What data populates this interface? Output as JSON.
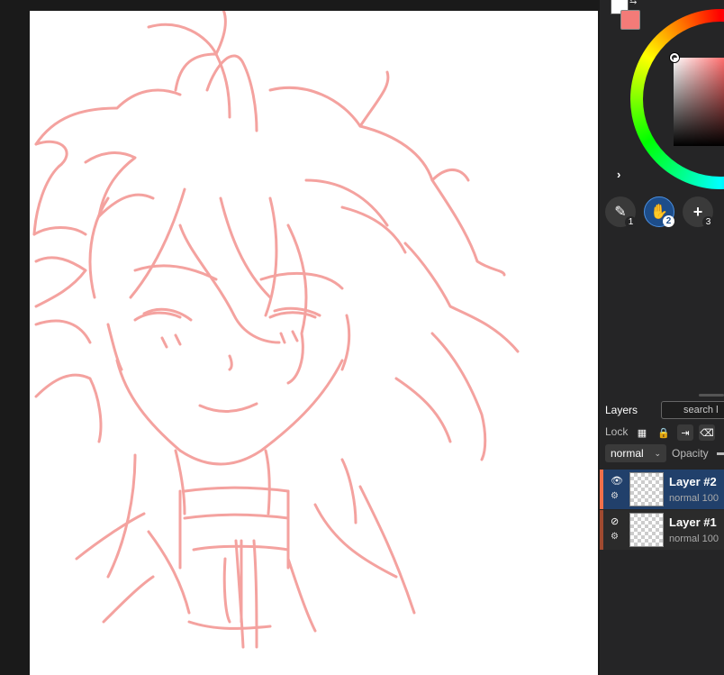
{
  "colors": {
    "foreground": "#f37b78",
    "background": "#ffffff",
    "stroke": "#f4a29f",
    "active_layer_edge": "#f0704a",
    "inactive_layer_edge": "#a04a30"
  },
  "icons": {
    "swap": "swap-colors-icon",
    "expand": "chevron-right-icon",
    "search": "search-icon"
  },
  "tools": [
    {
      "name": "brush",
      "icon": "brush-icon",
      "glyph": "✎",
      "number": "1",
      "active": false
    },
    {
      "name": "hand",
      "icon": "hand-icon",
      "glyph": "✋",
      "number": "2",
      "active": true
    },
    {
      "name": "add",
      "icon": "plus-icon",
      "glyph": "+",
      "number": "3",
      "active": false
    }
  ],
  "layers_panel": {
    "title": "Layers",
    "search_placeholder": "search l",
    "lock_label": "Lock",
    "blend_mode": "normal",
    "opacity_label": "Opacity"
  },
  "layers": [
    {
      "name": "Layer #2",
      "meta": "normal 100",
      "visible": true,
      "active": true
    },
    {
      "name": "Layer #1",
      "meta": "normal 100",
      "visible": false,
      "active": false
    }
  ]
}
